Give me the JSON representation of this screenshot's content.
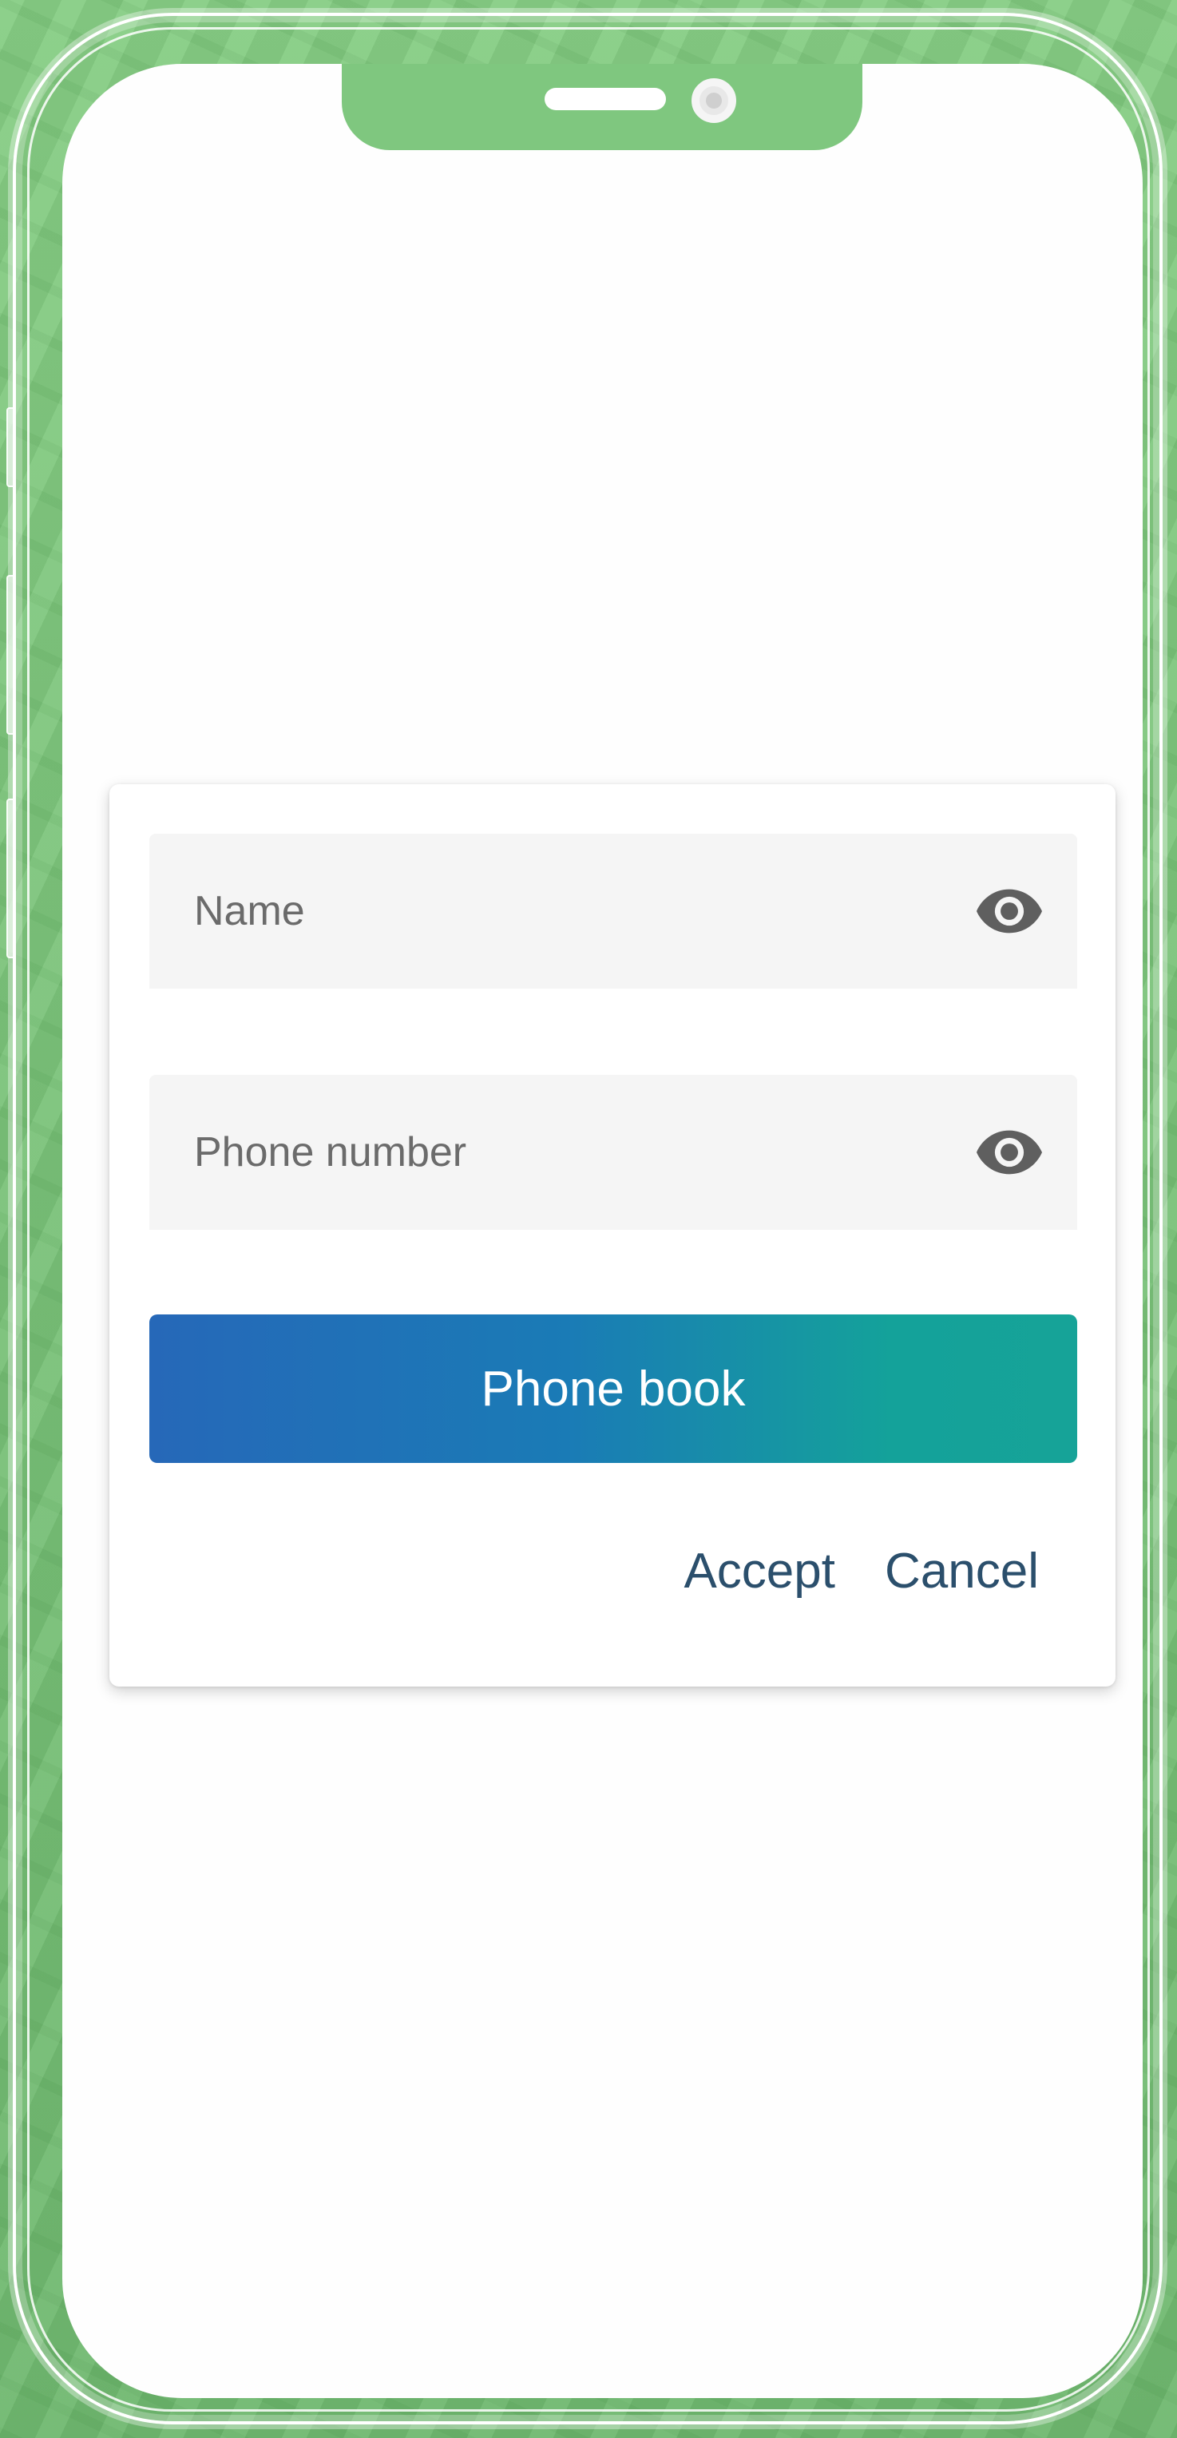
{
  "form": {
    "name_field": {
      "placeholder": "Name",
      "icon": "eye-icon"
    },
    "phone_field": {
      "placeholder": "Phone number",
      "icon": "eye-icon"
    },
    "primary_button": "Phone book",
    "accept_label": "Accept",
    "cancel_label": "Cancel"
  },
  "colors": {
    "background": "#7cc57c",
    "button_gradient_start": "#2668b8",
    "button_gradient_end": "#16a398",
    "action_text": "#2b4f6c"
  }
}
